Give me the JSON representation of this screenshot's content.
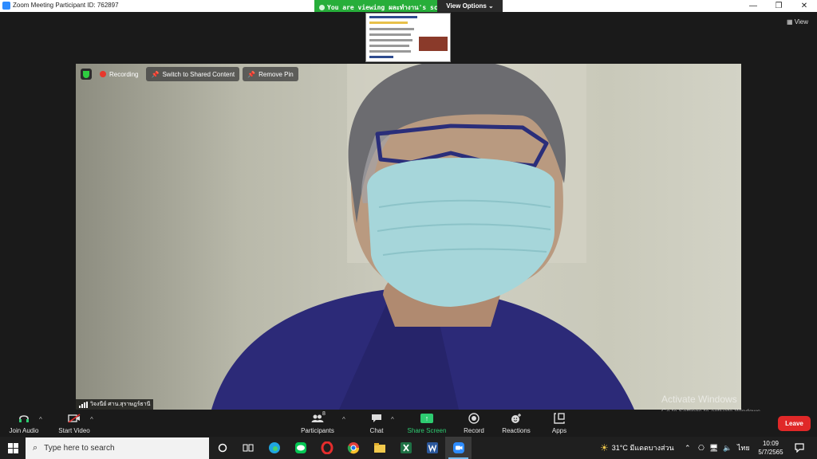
{
  "window": {
    "title": "Zoom Meeting Participant ID: 762897",
    "minimize": "—",
    "maximize": "❐",
    "close": "✕"
  },
  "banner": {
    "viewing_text": "You are viewing ผละทำงาน's screen",
    "view_options": "View Options ⌄"
  },
  "view_button": "▦ View",
  "meeting_controls": {
    "recording": "Recording",
    "switch_shared": "Switch to Shared Content",
    "remove_pin": "Remove Pin"
  },
  "participant_name": "วิจงนีย์ ศาน.สุราษฎร์ธานี",
  "toolbar": {
    "join_audio": "Join Audio",
    "start_video": "Start Video",
    "participants": "Participants",
    "participants_count": "8",
    "chat": "Chat",
    "share_screen": "Share Screen",
    "record": "Record",
    "reactions": "Reactions",
    "apps": "Apps",
    "leave": "Leave"
  },
  "watermark": {
    "line1": "Activate Windows",
    "line2": "Go to Settings to activate Windows."
  },
  "taskbar": {
    "search_placeholder": "Type here to search",
    "weather": "31°C มีแดดบางส่วน",
    "language": "ไทย",
    "time": "10:09",
    "date": "5/7/2565"
  },
  "colors": {
    "zoom_blue": "#2d8cff",
    "banner_green": "#27ae3a",
    "share_green": "#2ecc71",
    "leave_red": "#e02828"
  }
}
